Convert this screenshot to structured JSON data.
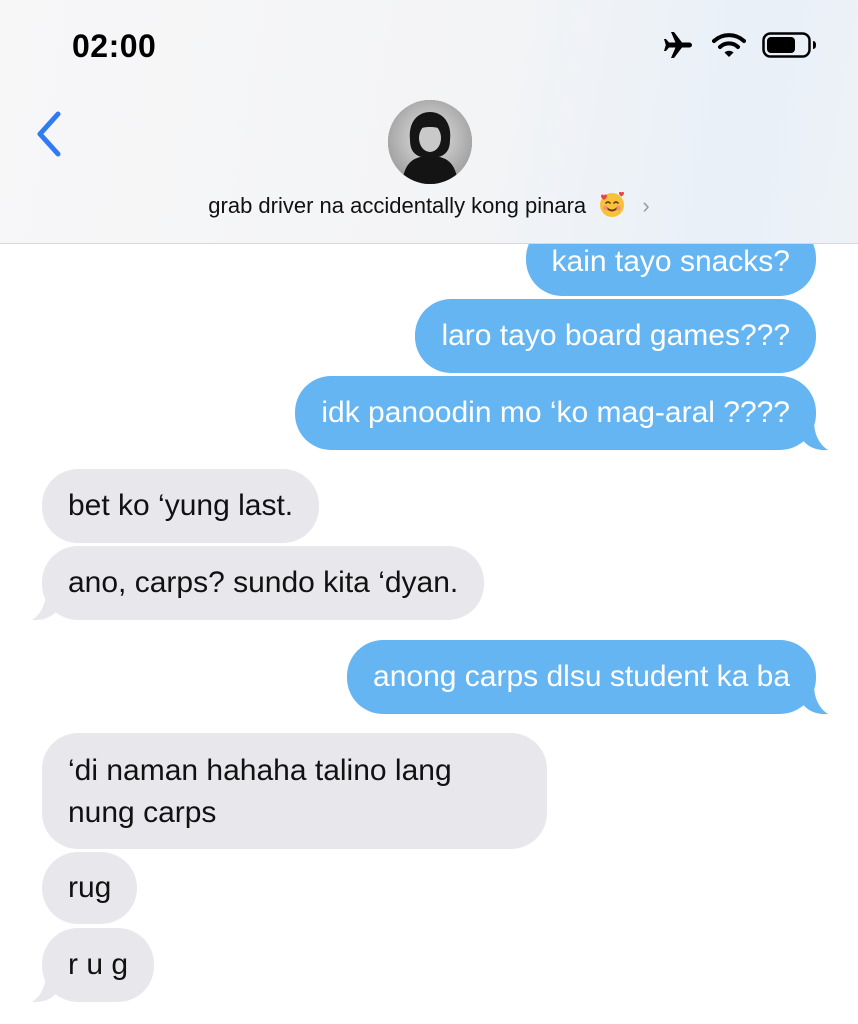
{
  "status_bar": {
    "time": "02:00",
    "icons": [
      "airplane-icon",
      "wifi-icon",
      "battery-icon"
    ]
  },
  "header": {
    "back_icon": "chevron-left-icon",
    "contact_name": "grab driver na accidentally kong pinara",
    "contact_emoji": "smiling-face-with-hearts-emoji",
    "disclosure": "›"
  },
  "colors": {
    "sent_bubble": "#66b5f3",
    "received_bubble": "#e8e7ec",
    "accent": "#2f7bf6"
  },
  "messages": [
    {
      "side": "sent",
      "text": "kain tayo snacks?"
    },
    {
      "side": "sent",
      "text": "laro tayo board games???"
    },
    {
      "side": "sent",
      "text": "idk panoodin mo ‘ko mag-aral ????"
    },
    {
      "side": "received",
      "text": "bet ko ‘yung last."
    },
    {
      "side": "received",
      "text": "ano, carps? sundo kita ‘dyan."
    },
    {
      "side": "sent",
      "text": "anong carps dlsu student ka ba"
    },
    {
      "side": "received",
      "line1": "‘di naman hahaha talino lang",
      "line2": "nung carps"
    },
    {
      "side": "received",
      "text": "rug"
    },
    {
      "side": "received",
      "text": "r u g"
    }
  ]
}
